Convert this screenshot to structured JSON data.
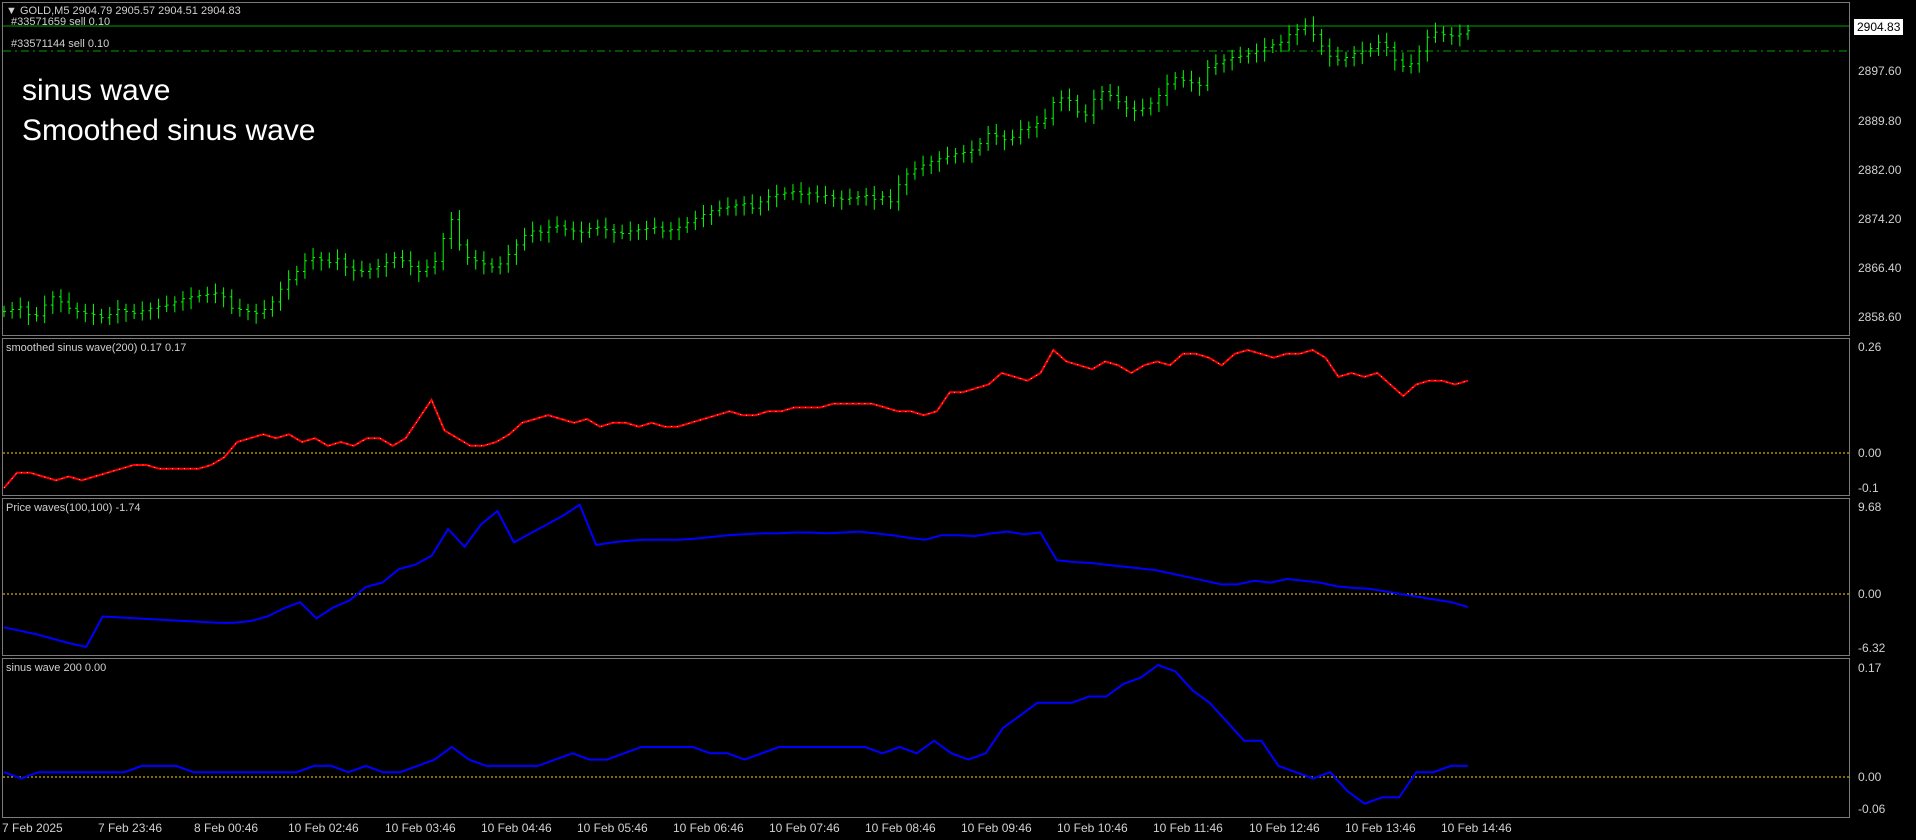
{
  "symbol_header": "GOLD,M5  2904.79 2905.57 2904.51 2904.83",
  "orders": [
    "#33571659 sell 0.10",
    "#33571144 sell 0.10"
  ],
  "overlay_labels": [
    "sinus wave",
    "Smoothed sinus wave"
  ],
  "current_price": "2904.83",
  "colors": {
    "candle": "#00ff00",
    "smoothed_line": "#ff0000",
    "smoothed_highlight": "#ffffff",
    "price_waves_line": "#0000ff",
    "sinus_line": "#0000ff",
    "zero_line": "#ffd700",
    "order_line": "#00a000",
    "grid_border": "#7a7a7a"
  },
  "main_scale": [
    "2897.60",
    "2889.80",
    "2882.00",
    "2874.20",
    "2866.40",
    "2858.60"
  ],
  "panes": {
    "smoothed": {
      "title": "smoothed sinus wave(200) 0.17 0.17",
      "scale": [
        "0.26",
        "0.00",
        "-0.1"
      ]
    },
    "price_waves": {
      "title": "Price waves(100,100) -1.74",
      "scale": [
        "9.68",
        "0.00",
        "-6.32"
      ]
    },
    "sinus": {
      "title": "sinus wave 200 0.00",
      "scale": [
        "0.17",
        "0.00",
        "-0.06"
      ]
    }
  },
  "time_axis": [
    "7 Feb 2025",
    "7 Feb 23:46",
    "8 Feb 00:46",
    "10 Feb 02:46",
    "10 Feb 03:46",
    "10 Feb 04:46",
    "10 Feb 05:46",
    "10 Feb 06:46",
    "10 Feb 07:46",
    "10 Feb 08:46",
    "10 Feb 09:46",
    "10 Feb 10:46",
    "10 Feb 11:46",
    "10 Feb 12:46",
    "10 Feb 13:46",
    "10 Feb 14:46"
  ],
  "chart_data": {
    "type": "line",
    "candle_closes": [
      2860.5,
      2860.8,
      2861.2,
      2860.0,
      2859.8,
      2861.5,
      2862.8,
      2862.0,
      2861.0,
      2860.5,
      2860.2,
      2860.0,
      2859.5,
      2860.0,
      2860.8,
      2860.5,
      2860.2,
      2860.6,
      2861.0,
      2861.3,
      2861.5,
      2862.0,
      2862.5,
      2862.8,
      2863.0,
      2863.2,
      2863.4,
      2862.8,
      2861.0,
      2860.8,
      2860.5,
      2860.2,
      2860.8,
      2862.0,
      2864.0,
      2865.5,
      2866.8,
      2868.5,
      2869.0,
      2868.6,
      2868.2,
      2868.8,
      2867.5,
      2867.0,
      2866.8,
      2867.2,
      2867.6,
      2868.2,
      2869.0,
      2868.5,
      2867.6,
      2866.8,
      2867.5,
      2868.4,
      2872.0,
      2875.0,
      2871.0,
      2869.0,
      2868.5,
      2868.0,
      2867.5,
      2868.0,
      2869.5,
      2871.0,
      2872.5,
      2873.2,
      2873.0,
      2873.8,
      2874.0,
      2873.5,
      2873.2,
      2873.0,
      2873.6,
      2873.8,
      2873.4,
      2873.0,
      2872.8,
      2873.2,
      2873.4,
      2873.6,
      2873.8,
      2873.2,
      2873.4,
      2873.8,
      2874.5,
      2875.2,
      2875.8,
      2876.4,
      2876.8,
      2877.0,
      2877.3,
      2877.5,
      2876.8,
      2877.8,
      2878.6,
      2879.0,
      2879.2,
      2879.4,
      2879.0,
      2879.2,
      2878.6,
      2878.8,
      2878.4,
      2878.2,
      2878.4,
      2878.6,
      2878.8,
      2878.2,
      2878.6,
      2877.8,
      2880.5,
      2882.2,
      2883.0,
      2883.6,
      2884.2,
      2884.6,
      2885.0,
      2885.4,
      2885.6,
      2886.0,
      2887.0,
      2888.6,
      2888.2,
      2887.6,
      2888.0,
      2889.2,
      2889.6,
      2890.2,
      2891.0,
      2893.5,
      2894.2,
      2893.8,
      2892.0,
      2891.5,
      2894.0,
      2895.2,
      2894.6,
      2893.6,
      2892.6,
      2892.2,
      2892.6,
      2893.4,
      2894.6,
      2896.4,
      2897.4,
      2897.0,
      2896.6,
      2896.2,
      2899.0,
      2899.6,
      2900.2,
      2900.6,
      2900.8,
      2901.2,
      2901.6,
      2902.2,
      2902.6,
      2903.0,
      2904.2,
      2905.0,
      2905.6,
      2904.2,
      2902.4,
      2900.8,
      2900.2,
      2900.6,
      2901.2,
      2901.6,
      2902.0,
      2903.0,
      2902.2,
      2900.2,
      2899.2,
      2899.6,
      2901.6,
      2903.8,
      2904.6,
      2904.2,
      2904.0,
      2904.3,
      2904.83
    ],
    "smoothed_sinus_wave": [
      -0.1,
      -0.06,
      -0.06,
      -0.07,
      -0.08,
      -0.07,
      -0.08,
      -0.07,
      -0.06,
      -0.05,
      -0.04,
      -0.04,
      -0.05,
      -0.05,
      -0.05,
      -0.05,
      -0.04,
      -0.02,
      0.02,
      0.03,
      0.04,
      0.03,
      0.04,
      0.02,
      0.03,
      0.01,
      0.02,
      0.01,
      0.03,
      0.03,
      0.01,
      0.03,
      0.08,
      0.13,
      0.05,
      0.03,
      0.01,
      0.01,
      0.02,
      0.04,
      0.07,
      0.08,
      0.09,
      0.08,
      0.07,
      0.08,
      0.06,
      0.07,
      0.07,
      0.06,
      0.07,
      0.06,
      0.06,
      0.07,
      0.08,
      0.09,
      0.1,
      0.09,
      0.09,
      0.1,
      0.1,
      0.11,
      0.11,
      0.11,
      0.12,
      0.12,
      0.12,
      0.12,
      0.11,
      0.1,
      0.1,
      0.09,
      0.1,
      0.15,
      0.15,
      0.16,
      0.17,
      0.2,
      0.19,
      0.18,
      0.2,
      0.26,
      0.23,
      0.22,
      0.21,
      0.23,
      0.22,
      0.2,
      0.22,
      0.23,
      0.22,
      0.25,
      0.25,
      0.24,
      0.22,
      0.25,
      0.26,
      0.25,
      0.24,
      0.25,
      0.25,
      0.26,
      0.24,
      0.19,
      0.2,
      0.19,
      0.2,
      0.17,
      0.14,
      0.17,
      0.18,
      0.18,
      0.17,
      0.18
    ],
    "price_waves": [
      -4.0,
      -4.4,
      -4.8,
      -5.3,
      -5.8,
      -6.2,
      -2.8,
      -2.9,
      -3.0,
      -3.1,
      -3.2,
      -3.3,
      -3.4,
      -3.5,
      -3.5,
      -3.3,
      -2.8,
      -1.9,
      -1.2,
      -3.0,
      -1.8,
      -1.0,
      0.5,
      1.0,
      2.5,
      3.0,
      4.0,
      7.0,
      5.0,
      7.5,
      9.0,
      5.5,
      6.5,
      7.5,
      8.5,
      9.7,
      5.2,
      5.5,
      5.7,
      5.8,
      5.8,
      5.8,
      5.9,
      6.1,
      6.3,
      6.4,
      6.5,
      6.5,
      6.6,
      6.6,
      6.5,
      6.6,
      6.7,
      6.5,
      6.3,
      6.0,
      5.8,
      6.3,
      6.3,
      6.2,
      6.5,
      6.7,
      6.4,
      6.6,
      3.5,
      3.3,
      3.2,
      3.0,
      2.8,
      2.6,
      2.4,
      2.0,
      1.6,
      1.2,
      0.8,
      0.8,
      1.2,
      1.0,
      1.4,
      1.2,
      1.0,
      0.6,
      0.4,
      0.3,
      0.0,
      -0.3,
      -0.6,
      -0.9,
      -1.2,
      -1.74
    ],
    "sinus_wave": [
      0.0,
      -0.01,
      0.0,
      0.0,
      0.0,
      0.0,
      0.0,
      0.0,
      0.01,
      0.01,
      0.01,
      0.0,
      0.0,
      0.0,
      0.0,
      0.0,
      0.0,
      0.0,
      0.01,
      0.01,
      0.0,
      0.01,
      0.0,
      0.0,
      0.01,
      0.02,
      0.04,
      0.02,
      0.01,
      0.01,
      0.01,
      0.01,
      0.02,
      0.03,
      0.02,
      0.02,
      0.03,
      0.04,
      0.04,
      0.04,
      0.04,
      0.03,
      0.03,
      0.02,
      0.03,
      0.04,
      0.04,
      0.04,
      0.04,
      0.04,
      0.04,
      0.03,
      0.04,
      0.03,
      0.05,
      0.03,
      0.02,
      0.03,
      0.07,
      0.09,
      0.11,
      0.11,
      0.11,
      0.12,
      0.12,
      0.14,
      0.15,
      0.17,
      0.16,
      0.13,
      0.11,
      0.08,
      0.05,
      0.05,
      0.01,
      0.0,
      -0.01,
      0.0,
      -0.03,
      -0.05,
      -0.04,
      -0.04,
      0.0,
      0.0,
      0.01,
      0.01
    ]
  }
}
